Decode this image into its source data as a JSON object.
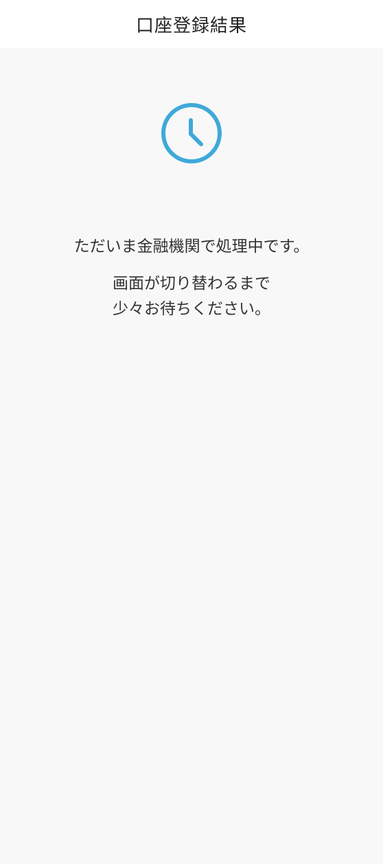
{
  "header": {
    "title": "口座登録結果"
  },
  "status": {
    "icon": "clock-icon",
    "accent_color": "#3fa9d9",
    "processing_message": "ただいま金融機関で処理中です。",
    "wait_line_1": "画面が切り替わるまで",
    "wait_line_2": "少々お待ちください。"
  }
}
